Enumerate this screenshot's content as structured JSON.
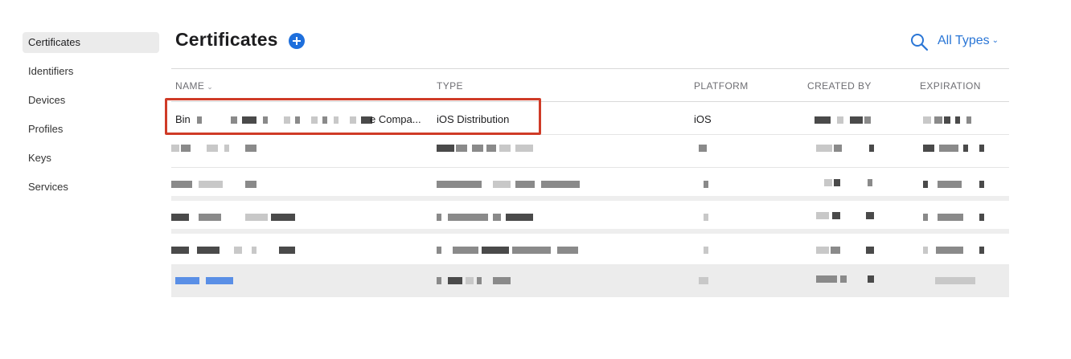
{
  "sidebar": {
    "items": [
      {
        "label": "Certificates",
        "active": true
      },
      {
        "label": "Identifiers"
      },
      {
        "label": "Devices"
      },
      {
        "label": "Profiles"
      },
      {
        "label": "Keys"
      },
      {
        "label": "Services"
      }
    ]
  },
  "header": {
    "title": "Certificates",
    "add_icon": "plus-circle-icon",
    "search_icon": "search-icon",
    "filter_label": "All Types",
    "filter_chevron": "⌄"
  },
  "table": {
    "columns": {
      "name": "NAME",
      "type": "TYPE",
      "platform": "PLATFORM",
      "created_by": "CREATED BY",
      "expiration": "EXPIRATION"
    },
    "sort_chevron": "⌄",
    "highlighted_row": {
      "name_prefix": "Bin",
      "name_suffix": "e Compa...",
      "type": "iOS Distribution",
      "platform": "iOS"
    }
  },
  "colors": {
    "accent": "#1e6fdc",
    "link": "#2a76d6",
    "highlight_border": "#cf3b27",
    "sidebar_active_bg": "#ebebeb"
  }
}
